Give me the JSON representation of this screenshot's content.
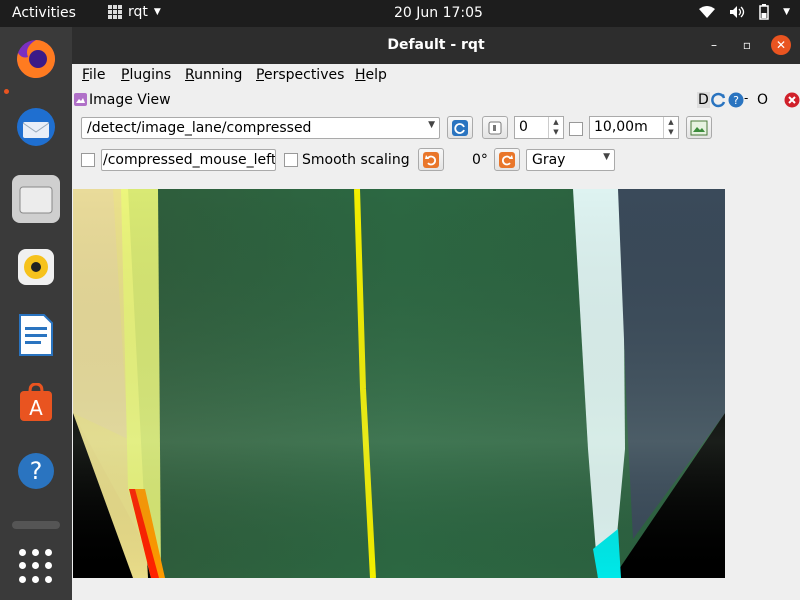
{
  "topbar": {
    "activities": "Activities",
    "app_name": "rqt",
    "clock": "20 Jun  17:05"
  },
  "dock": {
    "items": [
      "firefox-icon",
      "thunderbird-icon",
      "files-icon",
      "rhythmbox-icon",
      "writer-icon",
      "software-icon",
      "help-icon"
    ]
  },
  "window": {
    "title": "Default - rqt",
    "menu": [
      "File",
      "Plugins",
      "Running",
      "Perspectives",
      "Help"
    ]
  },
  "plugin": {
    "title": "Image View",
    "header_buttons": [
      "D",
      "O"
    ],
    "topic": "/detect/image_lane/compressed",
    "spin_value": "0",
    "duration": "10,00m",
    "mouse_topic": "/compressed_mouse_left",
    "smooth_scaling": "Smooth scaling",
    "rotation": "0°",
    "color_scheme": "Gray"
  },
  "colors": {
    "accent": "#e95420",
    "topbar": "#1d1d1d",
    "titlebar": "#2d2d2d",
    "close": "#e95420"
  }
}
